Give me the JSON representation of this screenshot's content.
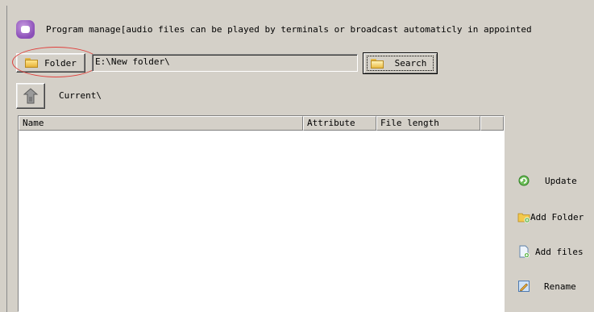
{
  "header": {
    "icon": "app-purple-icon",
    "title": "Program manage[audio files can be played by terminals or broadcast automaticly in appointed"
  },
  "toolbar": {
    "folder_label": "Folder",
    "path_value": "E:\\New folder\\",
    "search_label": "Search",
    "current_label": "Current\\"
  },
  "table": {
    "columns": [
      "Name",
      "Attribute",
      "File length",
      ""
    ],
    "rows": []
  },
  "side": {
    "update_label": "Update",
    "add_folder_label": "Add Folder",
    "add_files_label": "Add files",
    "rename_label": "Rename"
  },
  "colors": {
    "annotation_circle": "#e0403c",
    "app_icon": "#8b4fb8",
    "window_bg": "#d4d0c8"
  }
}
